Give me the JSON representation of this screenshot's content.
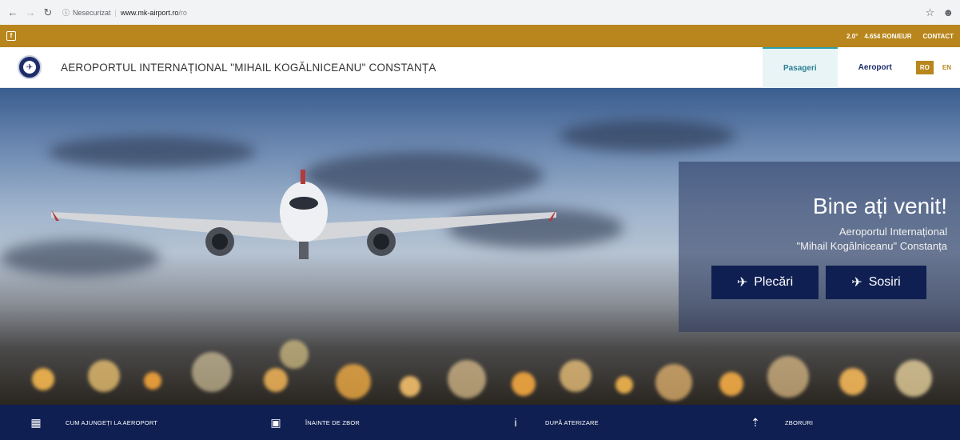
{
  "browser": {
    "security_label": "Nesecurizat",
    "url_host": "www.mk-airport.ro",
    "url_path": "/ro",
    "icons": [
      "back-arrow-icon",
      "forward-arrow-icon",
      "reload-icon",
      "info-icon",
      "star-icon",
      "account-icon"
    ]
  },
  "top_strip": {
    "weather": "2.0°",
    "exchange_rate": "4.654 RON/EUR",
    "contact_label": "CONTACT",
    "color": "#b8861c"
  },
  "header": {
    "site_title": "AEROPORTUL INTERNAȚIONAL \"MIHAIL KOGĂLNICEANU\" CONSTANȚA",
    "nav": [
      {
        "label": "Pasageri",
        "active": true
      },
      {
        "label": "Aeroport",
        "active": false
      }
    ],
    "languages": [
      {
        "label": "RO",
        "active": true
      },
      {
        "label": "EN",
        "active": false
      }
    ]
  },
  "hero": {
    "welcome_title": "Bine ați venit!",
    "welcome_line1": "Aeroportul Internațional",
    "welcome_line2": "\"Mihail Kogălniceanu\" Constanța",
    "departures_label": "Plecări",
    "arrivals_label": "Sosiri"
  },
  "bottom_nav": {
    "items": [
      {
        "label": "CUM AJUNGEȚI LA AEROPORT",
        "icon": "bus-icon"
      },
      {
        "label": "ÎNAINTE DE ZBOR",
        "icon": "luggage-icon"
      },
      {
        "label": "DUPĂ ATERIZARE",
        "icon": "info-icon"
      },
      {
        "label": "ZBORURI",
        "icon": "signpost-icon"
      }
    ],
    "color": "#0f1f52"
  }
}
